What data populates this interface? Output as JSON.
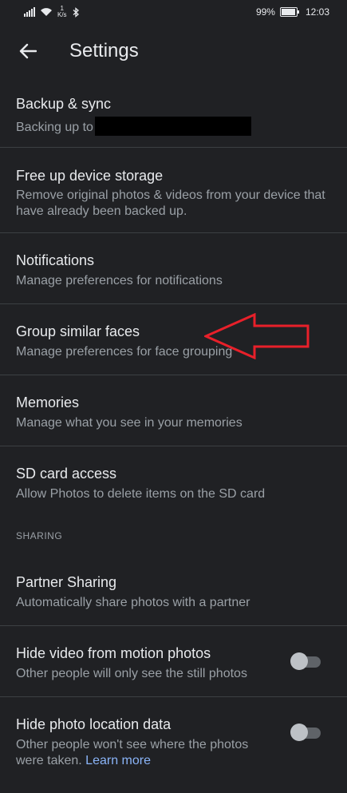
{
  "status": {
    "speed_top": "1",
    "speed_unit": "K/s",
    "battery": "99%",
    "time": "12:03"
  },
  "appbar": {
    "title": "Settings"
  },
  "items": [
    {
      "title": "Backup & sync",
      "subtitle": "Backing up to"
    },
    {
      "title": "Free up device storage",
      "subtitle": "Remove original photos & videos from your device that have already been backed up."
    },
    {
      "title": "Notifications",
      "subtitle": "Manage preferences for notifications"
    },
    {
      "title": "Group similar faces",
      "subtitle": "Manage preferences for face grouping"
    },
    {
      "title": "Memories",
      "subtitle": "Manage what you see in your memories"
    },
    {
      "title": "SD card access",
      "subtitle": "Allow Photos to delete items on the SD card"
    }
  ],
  "sharing": {
    "header": "SHARING",
    "items": [
      {
        "title": "Partner Sharing",
        "subtitle": "Automatically share photos with a partner"
      },
      {
        "title": "Hide video from motion photos",
        "subtitle": "Other people will only see the still photos",
        "toggle_on": false
      },
      {
        "title": "Hide photo location data",
        "subtitle": "Other people won't see where the photos were taken.",
        "link": "Learn more",
        "toggle_on": false
      }
    ]
  },
  "annotation": {
    "arrow_color": "#e8202a"
  }
}
